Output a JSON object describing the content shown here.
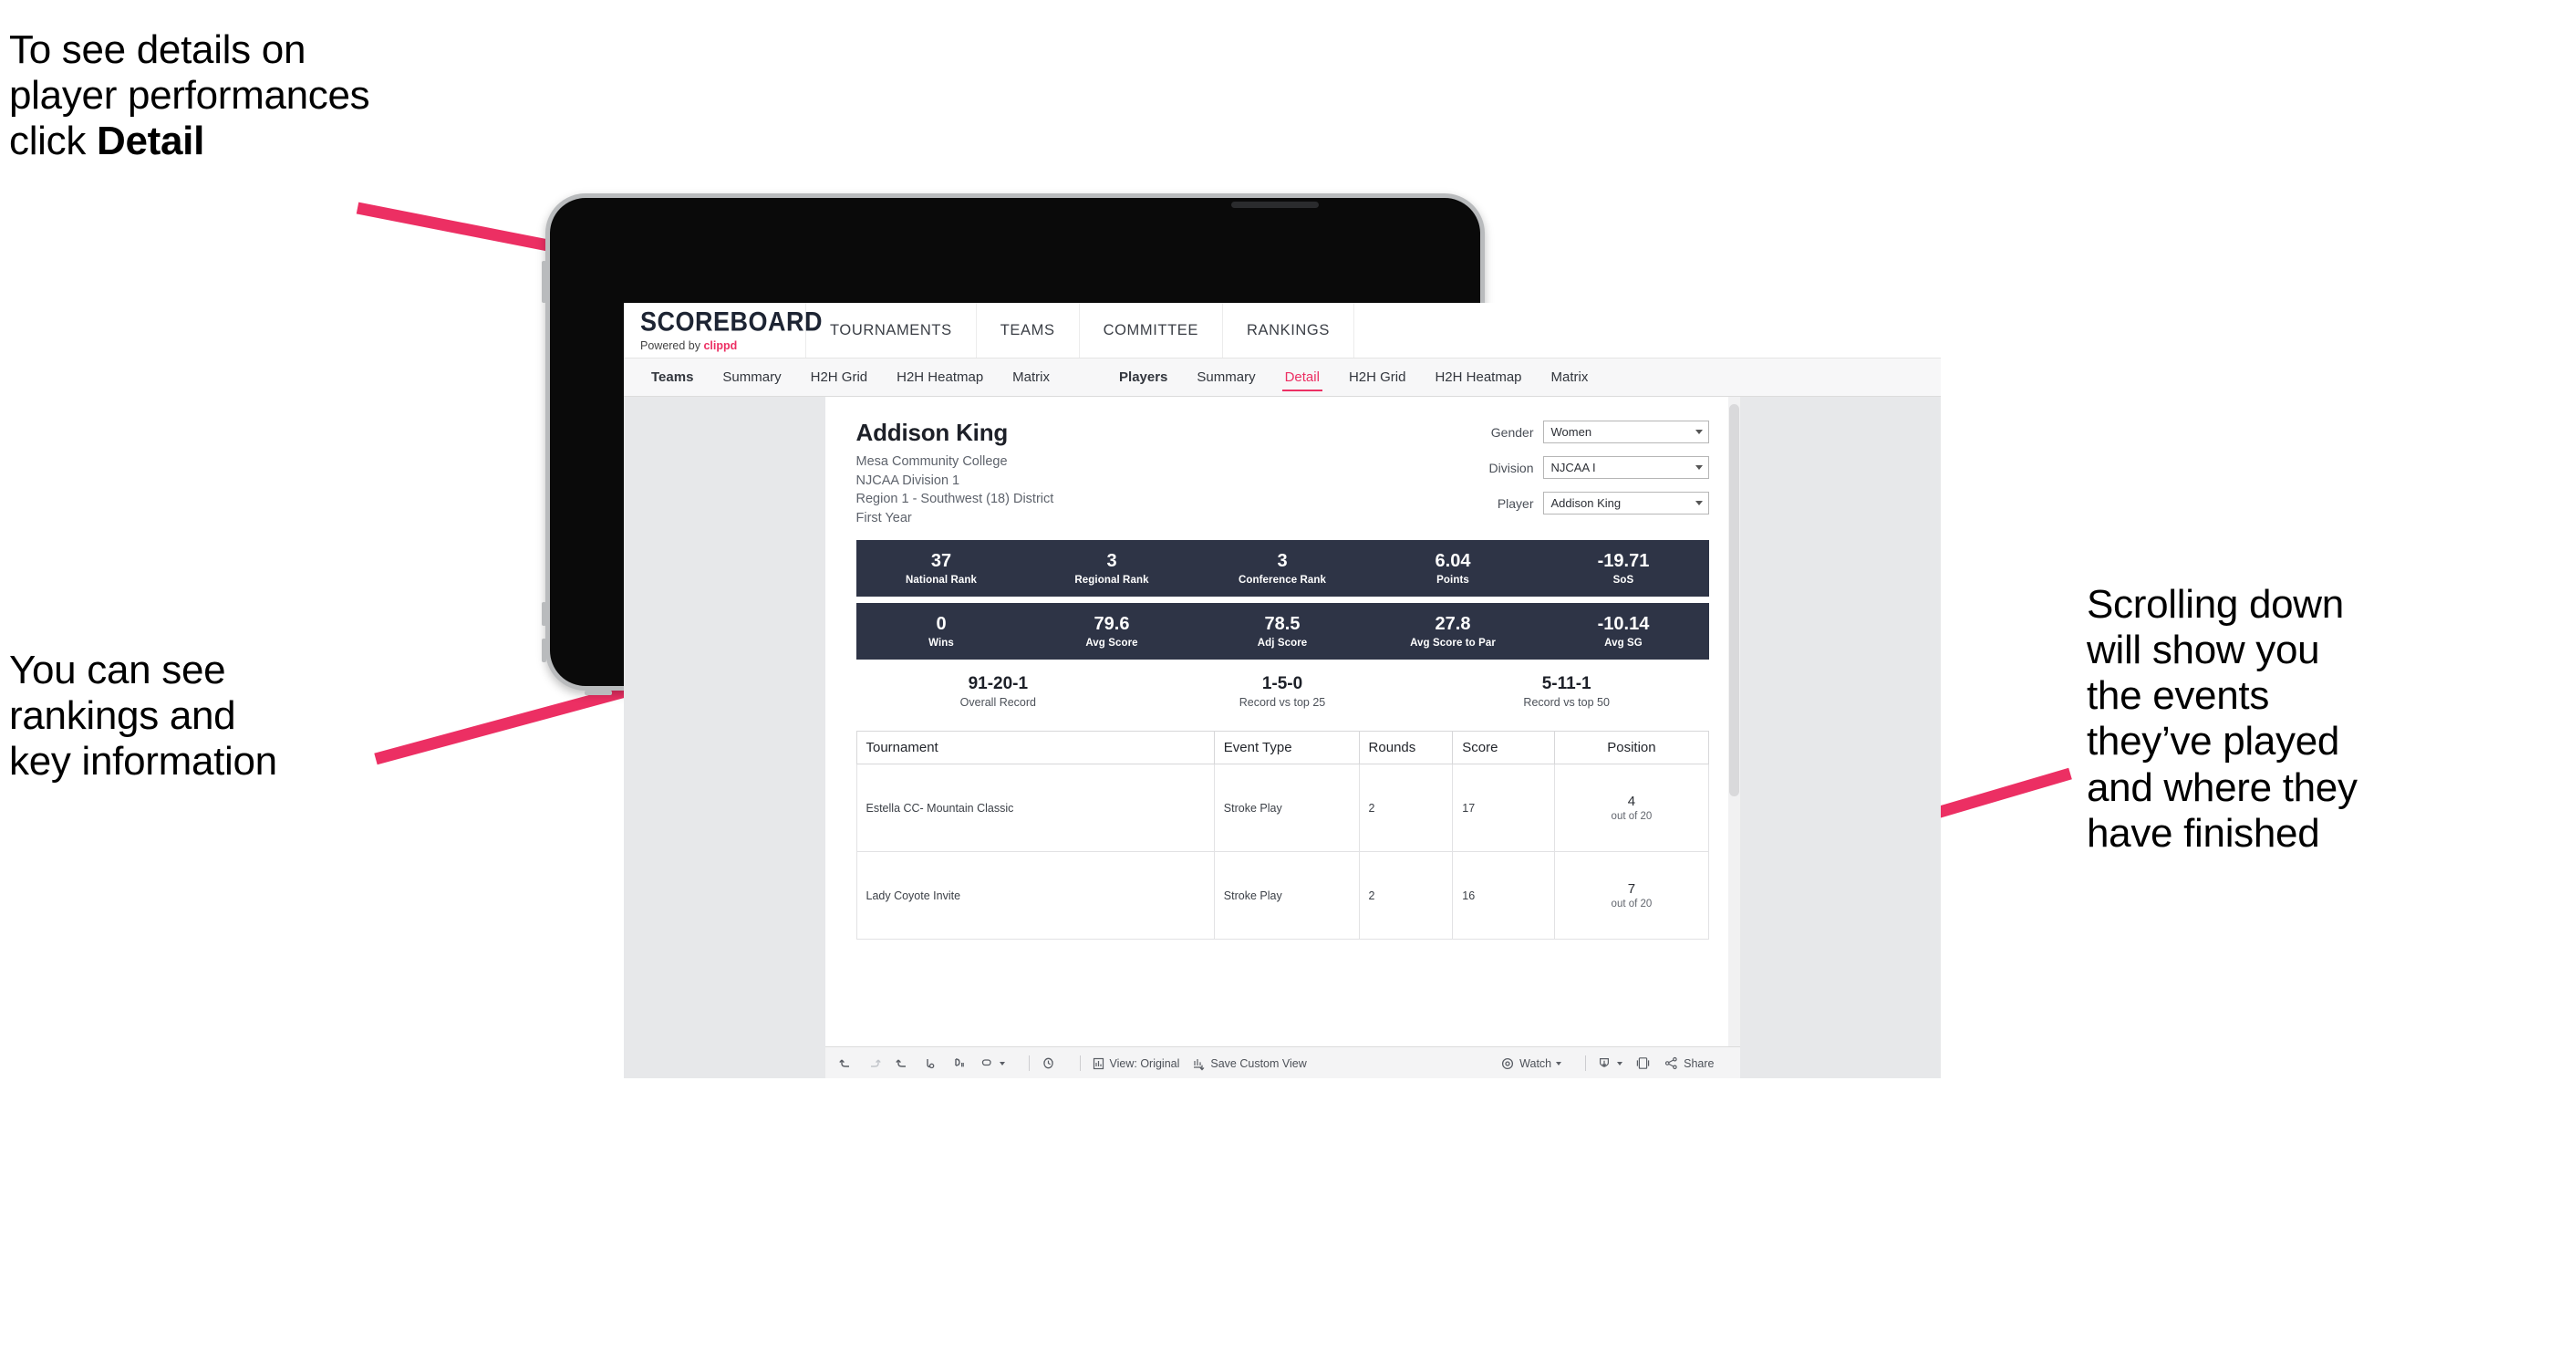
{
  "annotations": {
    "top_left": "To see details on\nplayer performances\nclick ",
    "top_left_bold": "Detail",
    "mid_left": "You can see\nrankings and\nkey information",
    "right": "Scrolling down\nwill show you\nthe events\nthey’ve played\nand where they\nhave finished"
  },
  "colors": {
    "accent_pink": "#ec2f63",
    "band_navy": "#2e3446",
    "arrow_pink": "#ec2f63"
  },
  "app": {
    "logo_main": "SCOREBOARD",
    "logo_sub_prefix": "Powered by ",
    "logo_sub_brand": "clippd",
    "topnav": [
      {
        "label": "TOURNAMENTS"
      },
      {
        "label": "TEAMS"
      },
      {
        "label": "COMMITTEE"
      },
      {
        "label": "RANKINGS"
      }
    ],
    "subnav": {
      "group_teams": {
        "label": "Teams",
        "items": [
          {
            "label": "Summary",
            "active": false
          },
          {
            "label": "H2H Grid",
            "active": false
          },
          {
            "label": "H2H Heatmap",
            "active": false
          },
          {
            "label": "Matrix",
            "active": false
          }
        ]
      },
      "group_players": {
        "label": "Players",
        "items": [
          {
            "label": "Summary",
            "active": false
          },
          {
            "label": "Detail",
            "active": true
          },
          {
            "label": "H2H Grid",
            "active": false
          },
          {
            "label": "H2H Heatmap",
            "active": false
          },
          {
            "label": "Matrix",
            "active": false
          }
        ]
      }
    }
  },
  "player": {
    "name": "Addison King",
    "school": "Mesa Community College",
    "division": "NJCAA Division 1",
    "region": "Region 1 - Southwest (18) District",
    "year": "First Year"
  },
  "filters": [
    {
      "label": "Gender",
      "value": "Women"
    },
    {
      "label": "Division",
      "value": "NJCAA I"
    },
    {
      "label": "Player",
      "value": "Addison King"
    }
  ],
  "stats_band_1": [
    {
      "value": "37",
      "label": "National Rank"
    },
    {
      "value": "3",
      "label": "Regional Rank"
    },
    {
      "value": "3",
      "label": "Conference Rank"
    },
    {
      "value": "6.04",
      "label": "Points"
    },
    {
      "value": "-19.71",
      "label": "SoS"
    }
  ],
  "stats_band_2": [
    {
      "value": "0",
      "label": "Wins"
    },
    {
      "value": "79.6",
      "label": "Avg Score"
    },
    {
      "value": "78.5",
      "label": "Adj Score"
    },
    {
      "value": "27.8",
      "label": "Avg Score to Par"
    },
    {
      "value": "-10.14",
      "label": "Avg SG"
    }
  ],
  "records": [
    {
      "value": "91-20-1",
      "label": "Overall Record"
    },
    {
      "value": "1-5-0",
      "label": "Record vs top 25"
    },
    {
      "value": "5-11-1",
      "label": "Record vs top 50"
    }
  ],
  "table": {
    "headers": [
      "Tournament",
      "Event Type",
      "Rounds",
      "Score",
      "Position"
    ],
    "rows": [
      {
        "tournament": "Estella CC- Mountain Classic",
        "event_type": "Stroke Play",
        "rounds": "2",
        "score": "17",
        "position_num": "4",
        "position_sub": "out of 20"
      },
      {
        "tournament": "Lady Coyote Invite",
        "event_type": "Stroke Play",
        "rounds": "2",
        "score": "16",
        "position_num": "7",
        "position_sub": "out of 20"
      }
    ]
  },
  "toolbar": {
    "undo": "undo-icon",
    "redo": "redo-icon",
    "revert": "revert-icon",
    "refresh": "refresh-icon",
    "pause": "pause-icon",
    "highlight": "highlight-icon",
    "clock": "clock-icon",
    "view_original": "View: Original",
    "save_custom_view": "Save Custom View",
    "watch": "Watch",
    "download": "download-icon",
    "fullscreen": "fullscreen-icon",
    "share": "Share"
  }
}
